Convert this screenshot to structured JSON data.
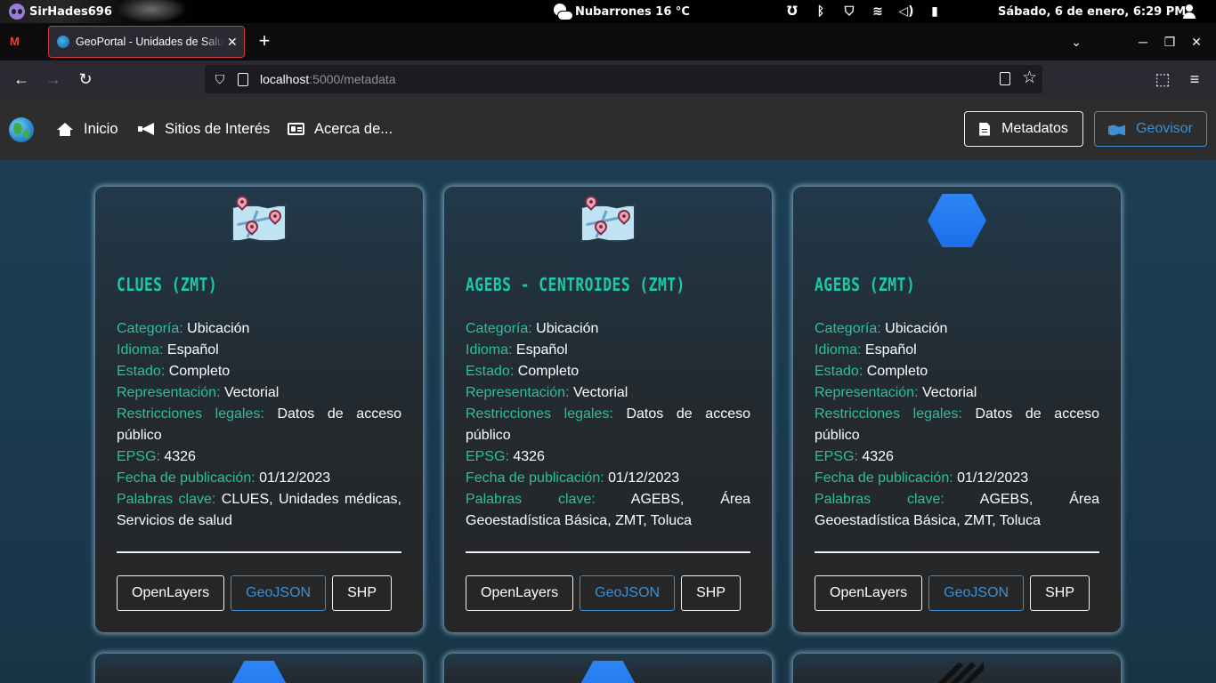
{
  "os": {
    "user": "SirHades696",
    "weather": "Nubarrones 16 °C",
    "clock": "Sábado,  6 de enero,  6:29 PM"
  },
  "browser": {
    "tab_title": "GeoPortal - Unidades de Salud",
    "url_host": "localhost",
    "url_path": ":5000/metadata"
  },
  "site": {
    "nav": {
      "home": "Inicio",
      "sites": "Sitios de Interés",
      "about": "Acerca de...",
      "metadata_btn": "Metadatos",
      "viewer_btn": "Geovisor"
    },
    "field_labels": {
      "category": "Categoría:",
      "language": "Idioma:",
      "status": "Estado:",
      "representation": "Representación:",
      "restrictions": "Restricciones legales:",
      "epsg": "EPSG:",
      "date": "Fecha de publicación:",
      "keywords": "Palabras clave:"
    },
    "buttons": {
      "openlayers": "OpenLayers",
      "geojson": "GeoJSON",
      "shp": "SHP"
    },
    "cards": [
      {
        "icon": "map-pins-icon",
        "title": "CLUES (ZMT)",
        "category": "Ubicación",
        "language": "Español",
        "status": "Completo",
        "representation": "Vectorial",
        "restrictions": "Datos de acceso público",
        "epsg": "4326",
        "date": "01/12/2023",
        "keywords": "CLUES, Unidades médicas, Servicios de salud"
      },
      {
        "icon": "map-pins-icon",
        "title": "AGEBS - CENTROIDES (ZMT)",
        "category": "Ubicación",
        "language": "Español",
        "status": "Completo",
        "representation": "Vectorial",
        "restrictions": "Datos de acceso público",
        "epsg": "4326",
        "date": "01/12/2023",
        "keywords": "AGEBS, Área Geoestadística Básica, ZMT, Toluca"
      },
      {
        "icon": "hexagon-icon",
        "title": "AGEBS (ZMT)",
        "category": "Ubicación",
        "language": "Español",
        "status": "Completo",
        "representation": "Vectorial",
        "restrictions": "Datos de acceso público",
        "epsg": "4326",
        "date": "01/12/2023",
        "keywords": "AGEBS, Área Geoestadística Básica, ZMT, Toluca"
      }
    ],
    "colors": {
      "accent": "#1dc9a8",
      "label": "#2cc09b",
      "link_blue": "#3d8fd1"
    }
  }
}
